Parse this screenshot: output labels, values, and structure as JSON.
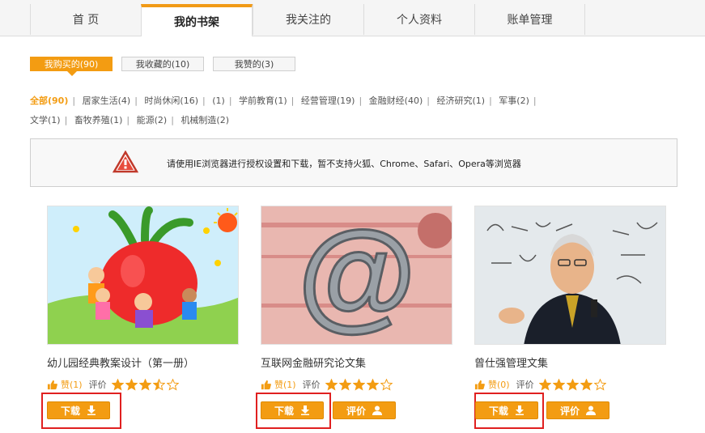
{
  "nav": {
    "tabs": [
      {
        "label": "首  页"
      },
      {
        "label": "我的书架"
      },
      {
        "label": "我关注的"
      },
      {
        "label": "个人资料"
      },
      {
        "label": "账单管理"
      }
    ]
  },
  "subtabs": [
    {
      "label": "我购买的(90)"
    },
    {
      "label": "我收藏的(10)"
    },
    {
      "label": "我赞的(3)"
    }
  ],
  "categories": [
    "全部(90)",
    "居家生活(4)",
    "时尚休闲(16)",
    "(1)",
    "学前教育(1)",
    "经营管理(19)",
    "金融财经(40)",
    "经济研究(1)",
    "军事(2)",
    "文学(1)",
    "畜牧养殖(1)",
    "能源(2)",
    "机械制造(2)"
  ],
  "notice": {
    "text": "请使用IE浏览器进行授权设置和下载，暂不支持火狐、Chrome、Safari、Opera等浏览器"
  },
  "books": [
    {
      "title": "幼儿园经典教案设计（第一册）",
      "likes": "赞(1)",
      "rating_label": "评价",
      "rating": 3.5,
      "download": "下载"
    },
    {
      "title": "互联网金融研究论文集",
      "likes": "赞(1)",
      "rating_label": "评价",
      "rating": 4,
      "download": "下载",
      "review": "评价"
    },
    {
      "title": "曾仕强管理文集",
      "likes": "赞(0)",
      "rating_label": "评价",
      "rating": 4,
      "download": "下载",
      "review": "评价"
    }
  ],
  "colors": {
    "accent": "#f39c12",
    "highlight": "#e02020"
  }
}
